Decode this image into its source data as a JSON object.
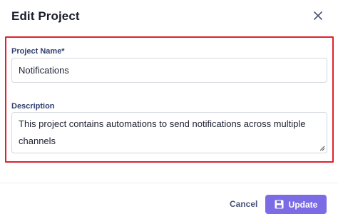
{
  "modal": {
    "title": "Edit Project",
    "close_icon": "close-icon"
  },
  "form": {
    "project_name_label": "Project Name*",
    "project_name_value": "Notifications",
    "description_label": "Description",
    "description_value": "This project contains automations to send notifications across multiple channels"
  },
  "footer": {
    "cancel_label": "Cancel",
    "update_label": "Update",
    "update_icon": "save-icon"
  },
  "colors": {
    "primary": "#7b6ce6",
    "highlight_border": "#e0202a",
    "label": "#2f3f6e",
    "cancel_text": "#4a5478"
  }
}
